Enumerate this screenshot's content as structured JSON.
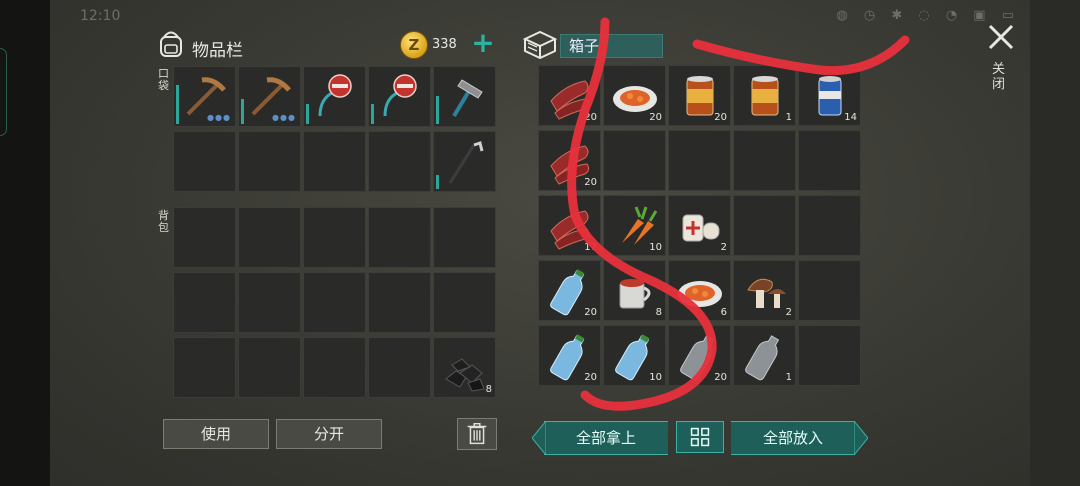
{
  "status_bar": {
    "time": "12:10"
  },
  "inventory": {
    "title": "物品栏",
    "coins": "338",
    "pockets_label": "口袋",
    "backpack_label": "背包",
    "slots": [
      {
        "row": 0,
        "col": 0,
        "item": "pickaxe",
        "count": "",
        "durability": 0.7,
        "dots": "●●●"
      },
      {
        "row": 0,
        "col": 1,
        "item": "pickaxe",
        "count": "",
        "durability": 0.45,
        "dots": "●●●"
      },
      {
        "row": 0,
        "col": 2,
        "item": "sign-hook",
        "count": "",
        "durability": 0.35,
        "dots": ""
      },
      {
        "row": 0,
        "col": 3,
        "item": "sign-hook",
        "count": "",
        "durability": 0.35,
        "dots": ""
      },
      {
        "row": 0,
        "col": 4,
        "item": "hammer",
        "count": "",
        "durability": 0.5,
        "dots": ""
      },
      {
        "row": 1,
        "col": 4,
        "item": "hoe",
        "count": "",
        "durability": 0.25,
        "dots": ""
      },
      {
        "row": 4,
        "col": 4,
        "item": "coal",
        "count": "8",
        "durability": null,
        "dots": ""
      }
    ]
  },
  "box": {
    "name": "箱子",
    "slots": [
      {
        "row": 0,
        "col": 0,
        "item": "raw-meat",
        "count": "20"
      },
      {
        "row": 0,
        "col": 1,
        "item": "stew-plate",
        "count": "20"
      },
      {
        "row": 0,
        "col": 2,
        "item": "canned-food",
        "count": "20"
      },
      {
        "row": 0,
        "col": 3,
        "item": "canned-food",
        "count": "1"
      },
      {
        "row": 0,
        "col": 4,
        "item": "soda-can",
        "count": "14"
      },
      {
        "row": 1,
        "col": 0,
        "item": "raw-meat",
        "count": "20"
      },
      {
        "row": 2,
        "col": 0,
        "item": "raw-meat",
        "count": "17"
      },
      {
        "row": 2,
        "col": 1,
        "item": "carrot",
        "count": "10"
      },
      {
        "row": 2,
        "col": 2,
        "item": "bandage",
        "count": "2"
      },
      {
        "row": 3,
        "col": 0,
        "item": "water-bottle",
        "count": "20"
      },
      {
        "row": 3,
        "col": 1,
        "item": "tea-mug",
        "count": "8"
      },
      {
        "row": 3,
        "col": 2,
        "item": "stew-plate",
        "count": "6"
      },
      {
        "row": 3,
        "col": 3,
        "item": "mushroom",
        "count": "2"
      },
      {
        "row": 4,
        "col": 0,
        "item": "water-bottle",
        "count": "20"
      },
      {
        "row": 4,
        "col": 1,
        "item": "water-bottle",
        "count": "10"
      },
      {
        "row": 4,
        "col": 2,
        "item": "empty-bottle",
        "count": "20"
      },
      {
        "row": 4,
        "col": 3,
        "item": "empty-bottle",
        "count": "1"
      }
    ]
  },
  "buttons": {
    "use": "使用",
    "split": "分开",
    "take_all": "全部拿上",
    "put_all": "全部放入",
    "close": "关闭"
  },
  "colors": {
    "accent": "#2bb3a0",
    "scribble": "#e8303c"
  }
}
